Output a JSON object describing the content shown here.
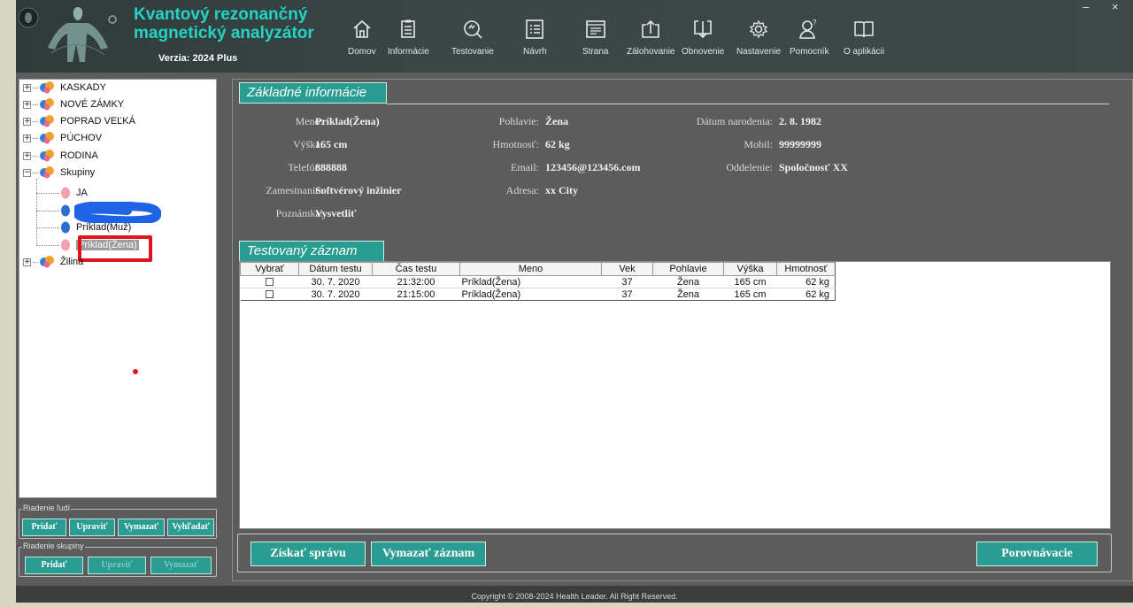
{
  "app": {
    "title_line1": "Kvantový rezonančný",
    "title_line2": "magnetický analyzátor",
    "version": "Verzia: 2024 Plus",
    "minimize": "–",
    "close": "×"
  },
  "nav": [
    {
      "label": "Domov",
      "icon": "home-icon"
    },
    {
      "label": "Informácie",
      "icon": "clipboard-icon"
    },
    {
      "label": "Testovanie",
      "icon": "test-dial-icon"
    },
    {
      "label": "Návrh",
      "icon": "list-icon"
    },
    {
      "label": "Strana",
      "icon": "window-icon"
    },
    {
      "label": "Zálohovanie",
      "icon": "upload-icon"
    },
    {
      "label": "Obnovenie",
      "icon": "download-icon"
    },
    {
      "label": "Nastavenie",
      "icon": "gear-icon"
    },
    {
      "label": "Pomocník",
      "icon": "user-help-icon"
    },
    {
      "label": "O aplikácii",
      "icon": "book-icon"
    }
  ],
  "tree": {
    "groups": [
      {
        "label": "KASKADY",
        "expander": "+"
      },
      {
        "label": "NOVÉ ZÁMKY",
        "expander": "+"
      },
      {
        "label": "POPRAD VEĽKÁ",
        "expander": "+"
      },
      {
        "label": "PÚCHOV",
        "expander": "+"
      },
      {
        "label": "RODINA",
        "expander": "+"
      },
      {
        "label": "Skupiny",
        "expander": "−"
      }
    ],
    "children": [
      {
        "label": "JA",
        "gender": "female"
      },
      {
        "label": "",
        "gender": "male"
      },
      {
        "label": "Príklad(Muž)",
        "gender": "male"
      },
      {
        "label": "Príklad(Žena)",
        "gender": "female"
      }
    ],
    "last_group": {
      "label": "Žilina",
      "expander": "+"
    }
  },
  "people_mgmt": {
    "legend": "Riadenie ľudí",
    "add": "Pridať",
    "edit": "Upraviť",
    "delete": "Vymazať",
    "search": "Vyhľadať"
  },
  "group_mgmt": {
    "legend": "Riadenie skupiny",
    "add": "Pridať",
    "edit": "Upraviť",
    "delete": "Vymazať"
  },
  "basic_info": {
    "title": "Základné informácie",
    "name_label": "Meno:",
    "name": "Príklad(Žena)",
    "gender_label": "Pohlavie:",
    "gender": "Žena",
    "dob_label": "Dátum narodenia:",
    "dob": "2. 8. 1982",
    "height_label": "Výška:",
    "height": "165 cm",
    "weight_label": "Hmotnosť:",
    "weight": "62 kg",
    "mobile_label": "Mobil:",
    "mobile": "99999999",
    "phone_label": "Telefón:",
    "phone": "888888",
    "email_label": "Email:",
    "email": "123456@123456.com",
    "dept_label": "Oddelenie:",
    "dept": "Spoločnosť XX",
    "job_label": "Zamestnanie:",
    "job": "Softvérový inžinier",
    "address_label": "Adresa:",
    "address": "xx City",
    "note_label": "Poznámka:",
    "note": "Vysvetliť"
  },
  "records": {
    "title": "Testovaný záznam",
    "columns": [
      "Vybrať",
      "Dátum testu",
      "Čas testu",
      "Meno",
      "Vek",
      "Pohlavie",
      "Výška",
      "Hmotnosť"
    ],
    "rows": [
      {
        "date": "30. 7. 2020",
        "time": "21:32:00",
        "name": "Príklad(Žena)",
        "age": "37",
        "gender": "Žena",
        "height": "165 cm",
        "weight": "62 kg"
      },
      {
        "date": "30. 7. 2020",
        "time": "21:15:00",
        "name": "Príklad(Žena)",
        "age": "37",
        "gender": "Žena",
        "height": "165 cm",
        "weight": "62 kg"
      }
    ]
  },
  "actions": {
    "get_report": "Získať správu",
    "delete_record": "Vymazať záznam",
    "compare": "Porovnávacie"
  },
  "footer": "Copyright © 2008-2024 Health Leader. All Right Reserved.",
  "colors": {
    "accent": "#2a9d92",
    "title": "#24d3c4",
    "highlight": "#e0141c"
  }
}
